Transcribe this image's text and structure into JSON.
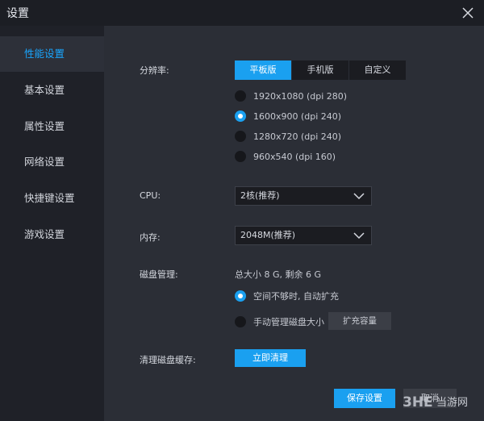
{
  "window": {
    "title": "设置"
  },
  "sidebar": {
    "items": [
      {
        "label": "性能设置",
        "active": true
      },
      {
        "label": "基本设置",
        "active": false
      },
      {
        "label": "属性设置",
        "active": false
      },
      {
        "label": "网络设置",
        "active": false
      },
      {
        "label": "快捷键设置",
        "active": false
      },
      {
        "label": "游戏设置",
        "active": false
      }
    ]
  },
  "resolution": {
    "label": "分辨率:",
    "tabs": [
      {
        "label": "平板版",
        "active": true
      },
      {
        "label": "手机版",
        "active": false
      },
      {
        "label": "自定义",
        "active": false
      }
    ],
    "options": [
      {
        "label": "1920x1080 (dpi 280)",
        "checked": false
      },
      {
        "label": "1600x900 (dpi 240)",
        "checked": true
      },
      {
        "label": "1280x720 (dpi 240)",
        "checked": false
      },
      {
        "label": "960x540 (dpi 160)",
        "checked": false
      }
    ]
  },
  "cpu": {
    "label": "CPU:",
    "value": "2核(推荐)"
  },
  "memory": {
    "label": "内存:",
    "value": "2048M(推荐)"
  },
  "disk": {
    "label": "磁盘管理:",
    "summary": "总大小 8 G, 剩余 6 G",
    "option_auto": "空间不够时, 自动扩充",
    "option_manual": "手动管理磁盘大小",
    "expand_button": "扩充容量"
  },
  "cache": {
    "label": "清理磁盘缓存:",
    "button": "立即清理"
  },
  "footer": {
    "save": "保存设置",
    "cancel": "取消"
  },
  "watermark": {
    "logo": "3HE",
    "text": "当游网"
  },
  "colors": {
    "accent": "#1aa0f0",
    "panel": "#2b2e36",
    "sidebar": "#1f2128"
  }
}
